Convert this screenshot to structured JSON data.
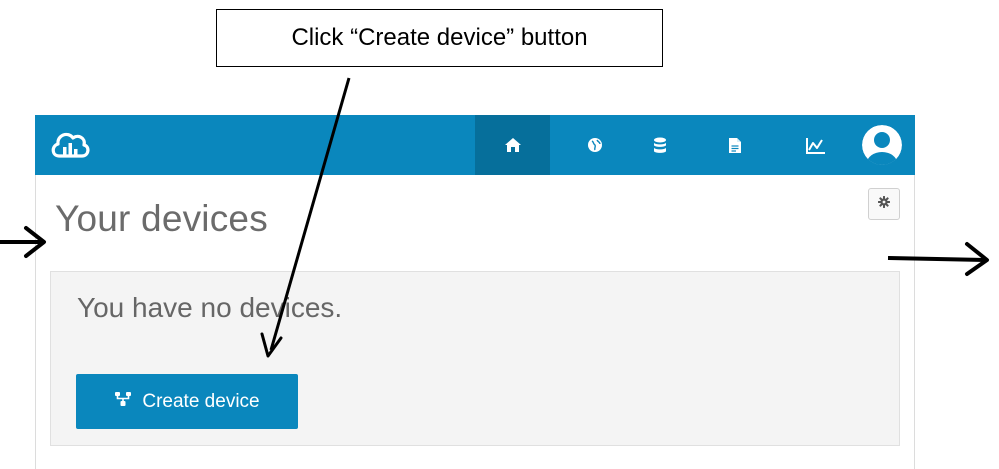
{
  "annotation": {
    "callout_text": "Click “Create device” button"
  },
  "app": {
    "brand_color": "#0a87bd",
    "active_nav_color": "#066f9b",
    "logo_icon": "cloud-chart-icon",
    "nav": [
      {
        "icon": "home-icon",
        "active": true
      },
      {
        "icon": "globe-icon",
        "active": false
      },
      {
        "icon": "database-icon",
        "active": false
      },
      {
        "icon": "document-icon",
        "active": false
      },
      {
        "icon": "line-chart-icon",
        "active": false
      },
      {
        "icon": "user-avatar-icon",
        "active": false
      }
    ],
    "settings_icon": "gear-icon"
  },
  "main": {
    "title": "Your devices",
    "empty_message": "You have no devices.",
    "create_button": {
      "label": "Create device",
      "icon": "device-network-icon"
    }
  }
}
